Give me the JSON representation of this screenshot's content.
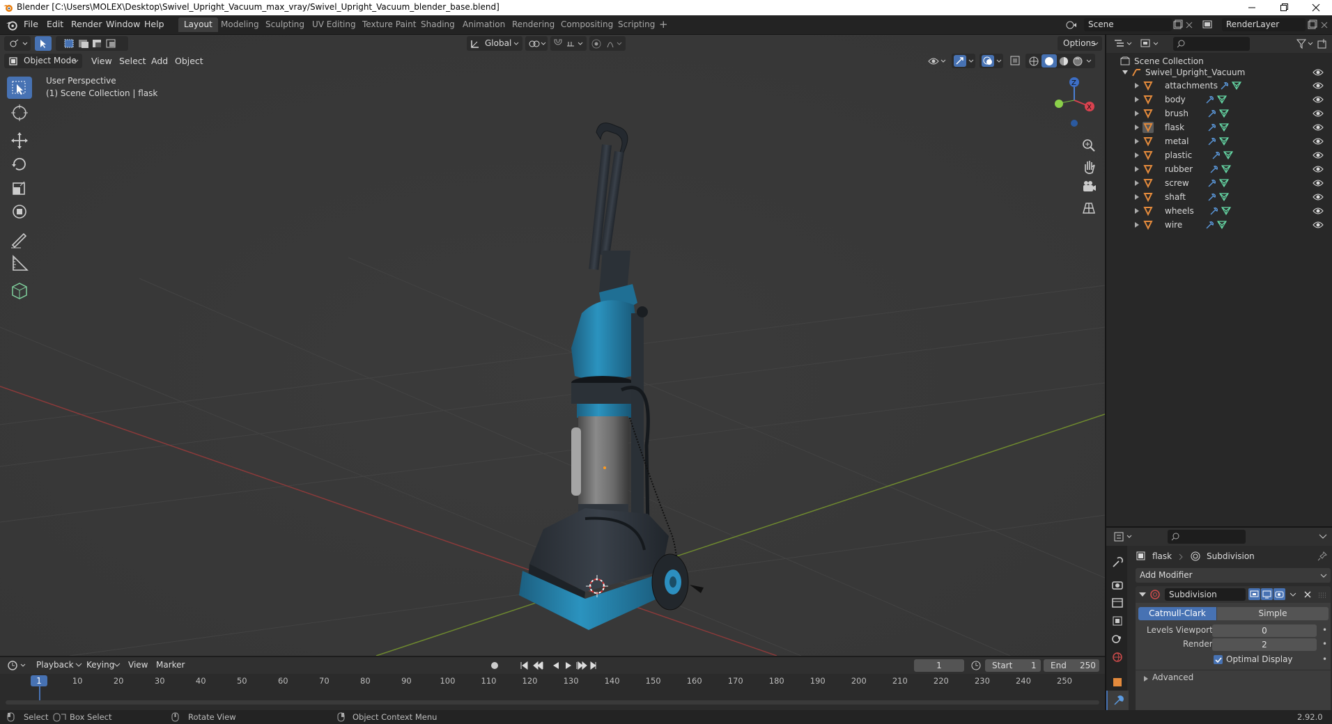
{
  "window": {
    "title": "Blender [C:\\Users\\MOLEX\\Desktop\\Swivel_Upright_Vacuum_max_vray/Swivel_Upright_Vacuum_blender_base.blend]"
  },
  "menubar": {
    "items": [
      "File",
      "Edit",
      "Render",
      "Window",
      "Help"
    ],
    "workspace_tabs": [
      "Layout",
      "Modeling",
      "Sculpting",
      "UV Editing",
      "Texture Paint",
      "Shading",
      "Animation",
      "Rendering",
      "Compositing",
      "Scripting"
    ],
    "active_tab": "Layout",
    "add_tab": "+",
    "scene": "Scene",
    "view_layer": "RenderLayer"
  },
  "viewport_header": {
    "transform_orientation": "Global",
    "options": "Options",
    "mode": "Object Mode",
    "menus": [
      "View",
      "Select",
      "Add",
      "Object"
    ]
  },
  "viewport": {
    "perspective": "User Perspective",
    "context": "(1) Scene Collection | flask",
    "gizmo_axes": [
      "Z",
      "X"
    ]
  },
  "outliner": {
    "root": "Scene Collection",
    "collection": "Swivel_Upright_Vacuum",
    "objects": [
      "attachments",
      "body",
      "brush",
      "flask",
      "metal",
      "plastic",
      "rubber",
      "screw",
      "shaft",
      "wheels",
      "wire"
    ],
    "selected": "flask"
  },
  "properties": {
    "object": "flask",
    "modifier_breadcrumb": "Subdivision",
    "add_modifier": "Add Modifier",
    "modifier_name": "Subdivision",
    "mode_catmull": "Catmull-Clark",
    "mode_simple": "Simple",
    "levels_viewport_label": "Levels Viewport",
    "levels_viewport_value": "0",
    "render_label": "Render",
    "render_value": "2",
    "optimal_display": "Optimal Display",
    "advanced": "Advanced"
  },
  "timeline": {
    "menus": [
      "Playback",
      "Keying",
      "View",
      "Marker"
    ],
    "current_frame": "1",
    "start_label": "Start",
    "start": "1",
    "end_label": "End",
    "end": "250",
    "ruler": [
      "1",
      "10",
      "20",
      "30",
      "40",
      "50",
      "60",
      "70",
      "80",
      "90",
      "100",
      "110",
      "120",
      "130",
      "140",
      "150",
      "160",
      "170",
      "180",
      "190",
      "200",
      "210",
      "220",
      "230",
      "240",
      "250"
    ]
  },
  "statusbar": {
    "select": "Select",
    "box_select": "Box Select",
    "rotate_view": "Rotate View",
    "context_menu": "Object Context Menu",
    "version": "2.92.0"
  },
  "colors": {
    "accent": "#4772b3",
    "object_orange": "#e38a3c",
    "mesh_green": "#66d9a6",
    "vacuum_blue": "#2689b0"
  }
}
